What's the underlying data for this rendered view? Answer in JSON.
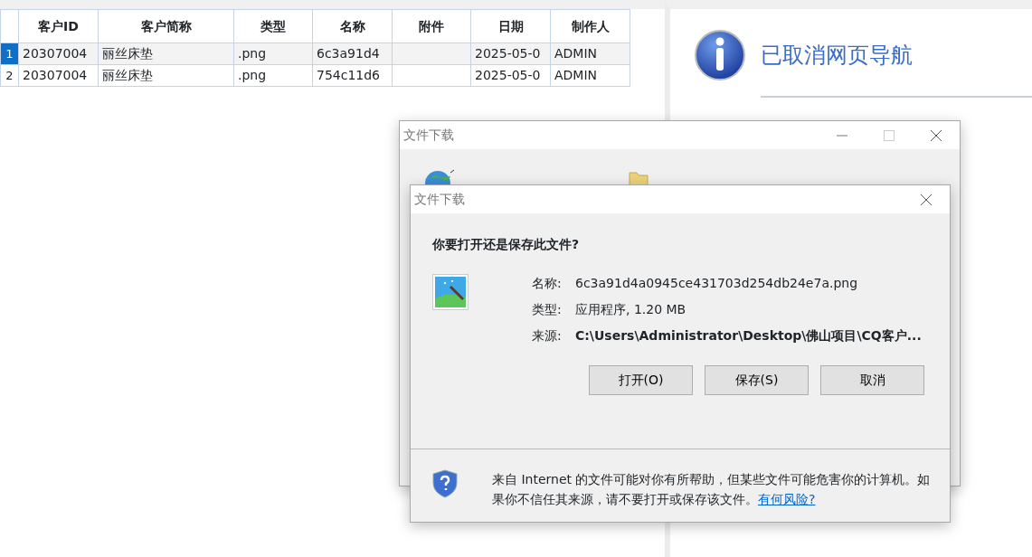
{
  "grid": {
    "columns": [
      "客户ID",
      "客户简称",
      "类型",
      "名称",
      "附件",
      "日期",
      "制作人"
    ],
    "rows": [
      {
        "number": "1",
        "selected": true,
        "cells": [
          "20307004",
          "丽丝床垫",
          ".png",
          "6c3a91d4",
          "",
          "2025-05-0",
          "ADMIN"
        ]
      },
      {
        "number": "2",
        "selected": false,
        "cells": [
          "20307004",
          "丽丝床垫",
          ".png",
          "754c11d6",
          "",
          "2025-05-0",
          "ADMIN"
        ]
      }
    ]
  },
  "info_panel": {
    "heading": "已取消网页导航"
  },
  "back_dialog": {
    "title": "文件下载"
  },
  "dialog": {
    "title": "文件下载",
    "question": "你要打开还是保存此文件?",
    "fields": [
      {
        "label": "名称:",
        "value": "6c3a91d4a0945ce431703d254db24e7a.png",
        "kind": "plain"
      },
      {
        "label": "类型:",
        "value": "应用程序, 1.20 MB",
        "kind": "plain"
      },
      {
        "label": "来源:",
        "value": "C:\\Users\\Administrator\\Desktop\\佛山项目\\CQ客户...",
        "kind": "path"
      }
    ],
    "buttons": [
      "打开(O)",
      "保存(S)",
      "取消"
    ],
    "warning": "来自 Internet 的文件可能对你有所帮助，但某些文件可能危害你的计算机。如果你不信任其来源，请不要打开或保存该文件。",
    "warning_link": "有何风险?"
  }
}
